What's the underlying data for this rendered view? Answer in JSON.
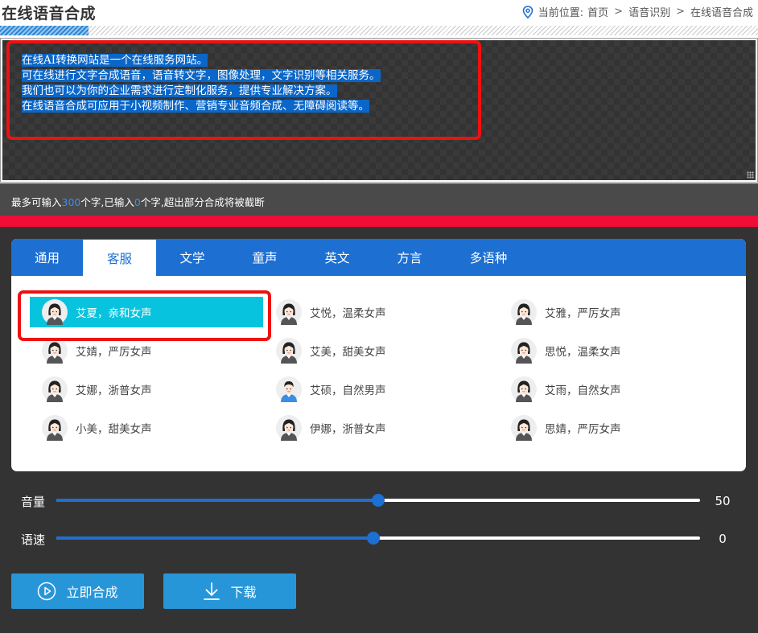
{
  "page": {
    "title": "在线语音合成"
  },
  "breadcrumb": {
    "prefix": "当前位置:",
    "items": [
      "首页",
      "语音识别",
      "在线语音合成"
    ],
    "separator": ">"
  },
  "editor": {
    "lines": [
      "在线AI转换网站是一个在线服务网站。",
      "可在线进行文字合成语音，语音转文字，图像处理，文字识别等相关服务。",
      "我们也可以为你的企业需求进行定制化服务，提供专业解决方案。",
      "在线语音合成可应用于小视频制作、营销专业音频合成、无障碍阅读等。"
    ]
  },
  "counter": {
    "part1": "最多可输入",
    "max": "300",
    "part2": "个字,已输入",
    "current": "0",
    "part3": "个字,超出部分合成将被截断"
  },
  "tabs": [
    {
      "label": "通用",
      "active": false
    },
    {
      "label": "客服",
      "active": true
    },
    {
      "label": "文学",
      "active": false
    },
    {
      "label": "童声",
      "active": false
    },
    {
      "label": "英文",
      "active": false
    },
    {
      "label": "方言",
      "active": false
    },
    {
      "label": "多语种",
      "active": false
    }
  ],
  "voices": [
    {
      "label": "艾夏，亲和女声",
      "selected": true,
      "avatar": "female-avatar-icon"
    },
    {
      "label": "艾悦，温柔女声",
      "selected": false,
      "avatar": "female-avatar-icon"
    },
    {
      "label": "艾雅，严厉女声",
      "selected": false,
      "avatar": "female-avatar-icon"
    },
    {
      "label": "艾婧，严厉女声",
      "selected": false,
      "avatar": "female-avatar-icon"
    },
    {
      "label": "艾美，甜美女声",
      "selected": false,
      "avatar": "female-avatar-icon"
    },
    {
      "label": "思悦，温柔女声",
      "selected": false,
      "avatar": "female-avatar-icon"
    },
    {
      "label": "艾娜，浙普女声",
      "selected": false,
      "avatar": "female-avatar-icon"
    },
    {
      "label": "艾硕，自然男声",
      "selected": false,
      "avatar": "male-avatar-icon"
    },
    {
      "label": "艾雨，自然女声",
      "selected": false,
      "avatar": "female-avatar-icon"
    },
    {
      "label": "小美，甜美女声",
      "selected": false,
      "avatar": "female-avatar-icon"
    },
    {
      "label": "伊娜，浙普女声",
      "selected": false,
      "avatar": "female-avatar-icon"
    },
    {
      "label": "思婧，严厉女声",
      "selected": false,
      "avatar": "female-avatar-icon"
    }
  ],
  "sliders": {
    "volume": {
      "label": "音量",
      "value": "50",
      "fraction": 0.5
    },
    "speed": {
      "label": "语速",
      "value": "0",
      "fraction": 0.4925
    }
  },
  "buttons": {
    "synthesize": "立即合成",
    "download": "下载"
  },
  "colors": {
    "accent": "#1d6fd2",
    "selected": "#08c3de",
    "highlight": "#ee1111",
    "button": "#2796d9"
  }
}
